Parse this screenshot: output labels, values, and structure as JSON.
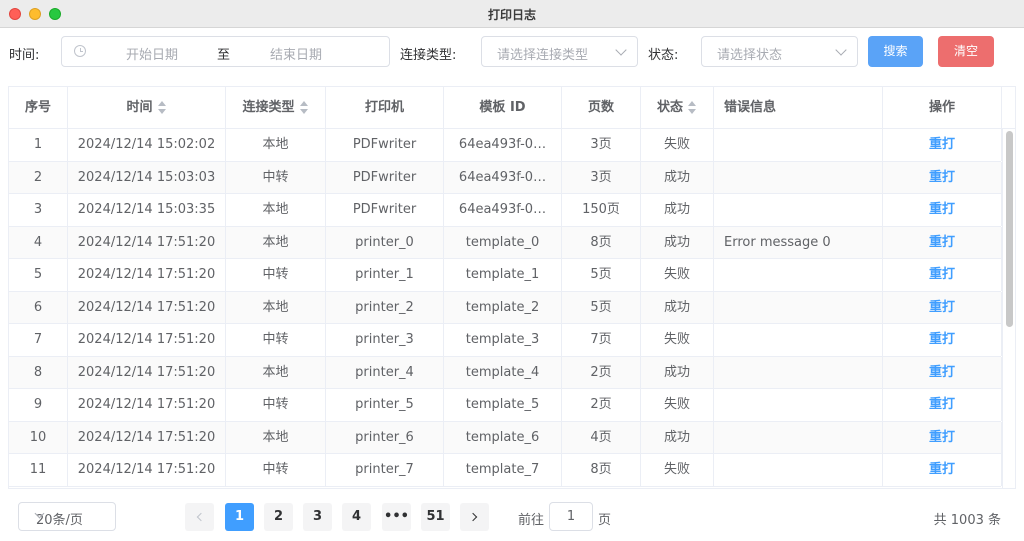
{
  "window": {
    "title": "打印日志"
  },
  "filters": {
    "time_label": "时间:",
    "start_placeholder": "开始日期",
    "range_separator": "至",
    "end_placeholder": "结束日期",
    "conn_type_label": "连接类型:",
    "conn_type_placeholder": "请选择连接类型",
    "status_label": "状态:",
    "status_placeholder": "请选择状态",
    "search_label": "搜索",
    "clear_label": "清空"
  },
  "table": {
    "headers": [
      "序号",
      "时间",
      "连接类型",
      "打印机",
      "模板 ID",
      "页数",
      "状态",
      "错误信息",
      "操作"
    ],
    "rows": [
      [
        "1",
        "2024/12/14 15:02:02",
        "本地",
        "PDFwriter",
        "64ea493f-0…",
        "3页",
        "失败",
        "",
        "重打"
      ],
      [
        "2",
        "2024/12/14 15:03:03",
        "中转",
        "PDFwriter",
        "64ea493f-0…",
        "3页",
        "成功",
        "",
        "重打"
      ],
      [
        "3",
        "2024/12/14 15:03:35",
        "本地",
        "PDFwriter",
        "64ea493f-0…",
        "150页",
        "成功",
        "",
        "重打"
      ],
      [
        "4",
        "2024/12/14 17:51:20",
        "本地",
        "printer_0",
        "template_0",
        "8页",
        "成功",
        "Error message 0",
        "重打"
      ],
      [
        "5",
        "2024/12/14 17:51:20",
        "中转",
        "printer_1",
        "template_1",
        "5页",
        "失败",
        "",
        "重打"
      ],
      [
        "6",
        "2024/12/14 17:51:20",
        "本地",
        "printer_2",
        "template_2",
        "5页",
        "成功",
        "",
        "重打"
      ],
      [
        "7",
        "2024/12/14 17:51:20",
        "中转",
        "printer_3",
        "template_3",
        "7页",
        "失败",
        "",
        "重打"
      ],
      [
        "8",
        "2024/12/14 17:51:20",
        "本地",
        "printer_4",
        "template_4",
        "2页",
        "成功",
        "",
        "重打"
      ],
      [
        "9",
        "2024/12/14 17:51:20",
        "中转",
        "printer_5",
        "template_5",
        "2页",
        "失败",
        "",
        "重打"
      ],
      [
        "10",
        "2024/12/14 17:51:20",
        "本地",
        "printer_6",
        "template_6",
        "4页",
        "成功",
        "",
        "重打"
      ],
      [
        "11",
        "2024/12/14 17:51:20",
        "中转",
        "printer_7",
        "template_7",
        "8页",
        "失败",
        "",
        "重打"
      ]
    ]
  },
  "pagination": {
    "page_size": "20条/页",
    "pages": [
      "1",
      "2",
      "3",
      "4",
      "•••",
      "51"
    ],
    "active_page": "1",
    "goto_prefix": "前往",
    "goto_value": "1",
    "goto_suffix": "页",
    "total": "共 1003 条"
  },
  "colors": {
    "primary": "#409eff",
    "search_button": "#5aa3f7",
    "clear_button": "#ed6e6e"
  }
}
